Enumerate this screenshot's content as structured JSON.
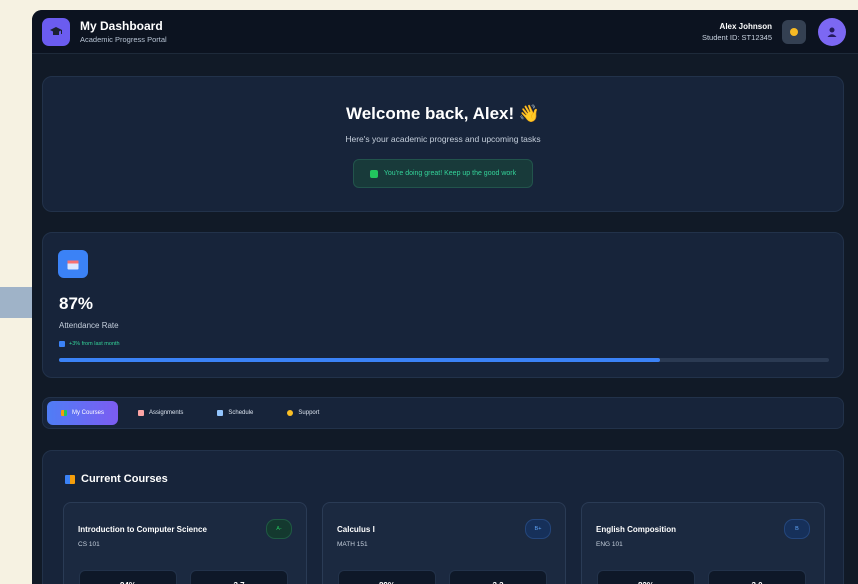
{
  "colors": {
    "page_bg": "#f6f2e2",
    "app_bg": "#111a27",
    "card_bg": "#17243a",
    "accent_purple": "#6b5cf0",
    "accent_blue": "#3b82f6",
    "success_green": "#34d399"
  },
  "header": {
    "title": "My Dashboard",
    "subtitle": "Academic Progress Portal",
    "logo_icon": "graduation-cap-icon",
    "user_name": "Alex Johnson",
    "student_id": "Student ID: ST12345",
    "theme_icon": "sun-icon",
    "avatar_icon": "user-icon"
  },
  "welcome": {
    "title": "Welcome back, Alex! 👋",
    "subtitle": "Here's your academic progress and upcoming tasks",
    "encouragement": "You're doing great! Keep up the good work"
  },
  "attendance": {
    "icon": "calendar-icon",
    "value": "87%",
    "label": "Attendance Rate",
    "trend": "+3% from last month",
    "progress_fraction": 0.78
  },
  "tabs": [
    {
      "label": "My Courses",
      "icon": "books-icon",
      "active": true
    },
    {
      "label": "Assignments",
      "icon": "document-icon",
      "active": false
    },
    {
      "label": "Schedule",
      "icon": "calendar-icon",
      "active": false
    },
    {
      "label": "Support",
      "icon": "handshake-icon",
      "active": false
    }
  ],
  "courses": {
    "heading": "Current Courses",
    "items": [
      {
        "name": "Introduction to Computer Science",
        "code": "CS 101",
        "grade": "A-",
        "grade_color": "#22c55e",
        "stat1": "94%",
        "stat2": "3.7"
      },
      {
        "name": "Calculus I",
        "code": "MATH 151",
        "grade": "B+",
        "grade_color": "#3b82f6",
        "stat1": "89%",
        "stat2": "3.3"
      },
      {
        "name": "English Composition",
        "code": "ENG 101",
        "grade": "B",
        "grade_color": "#3b82f6",
        "stat1": "82%",
        "stat2": "3.0"
      }
    ]
  }
}
